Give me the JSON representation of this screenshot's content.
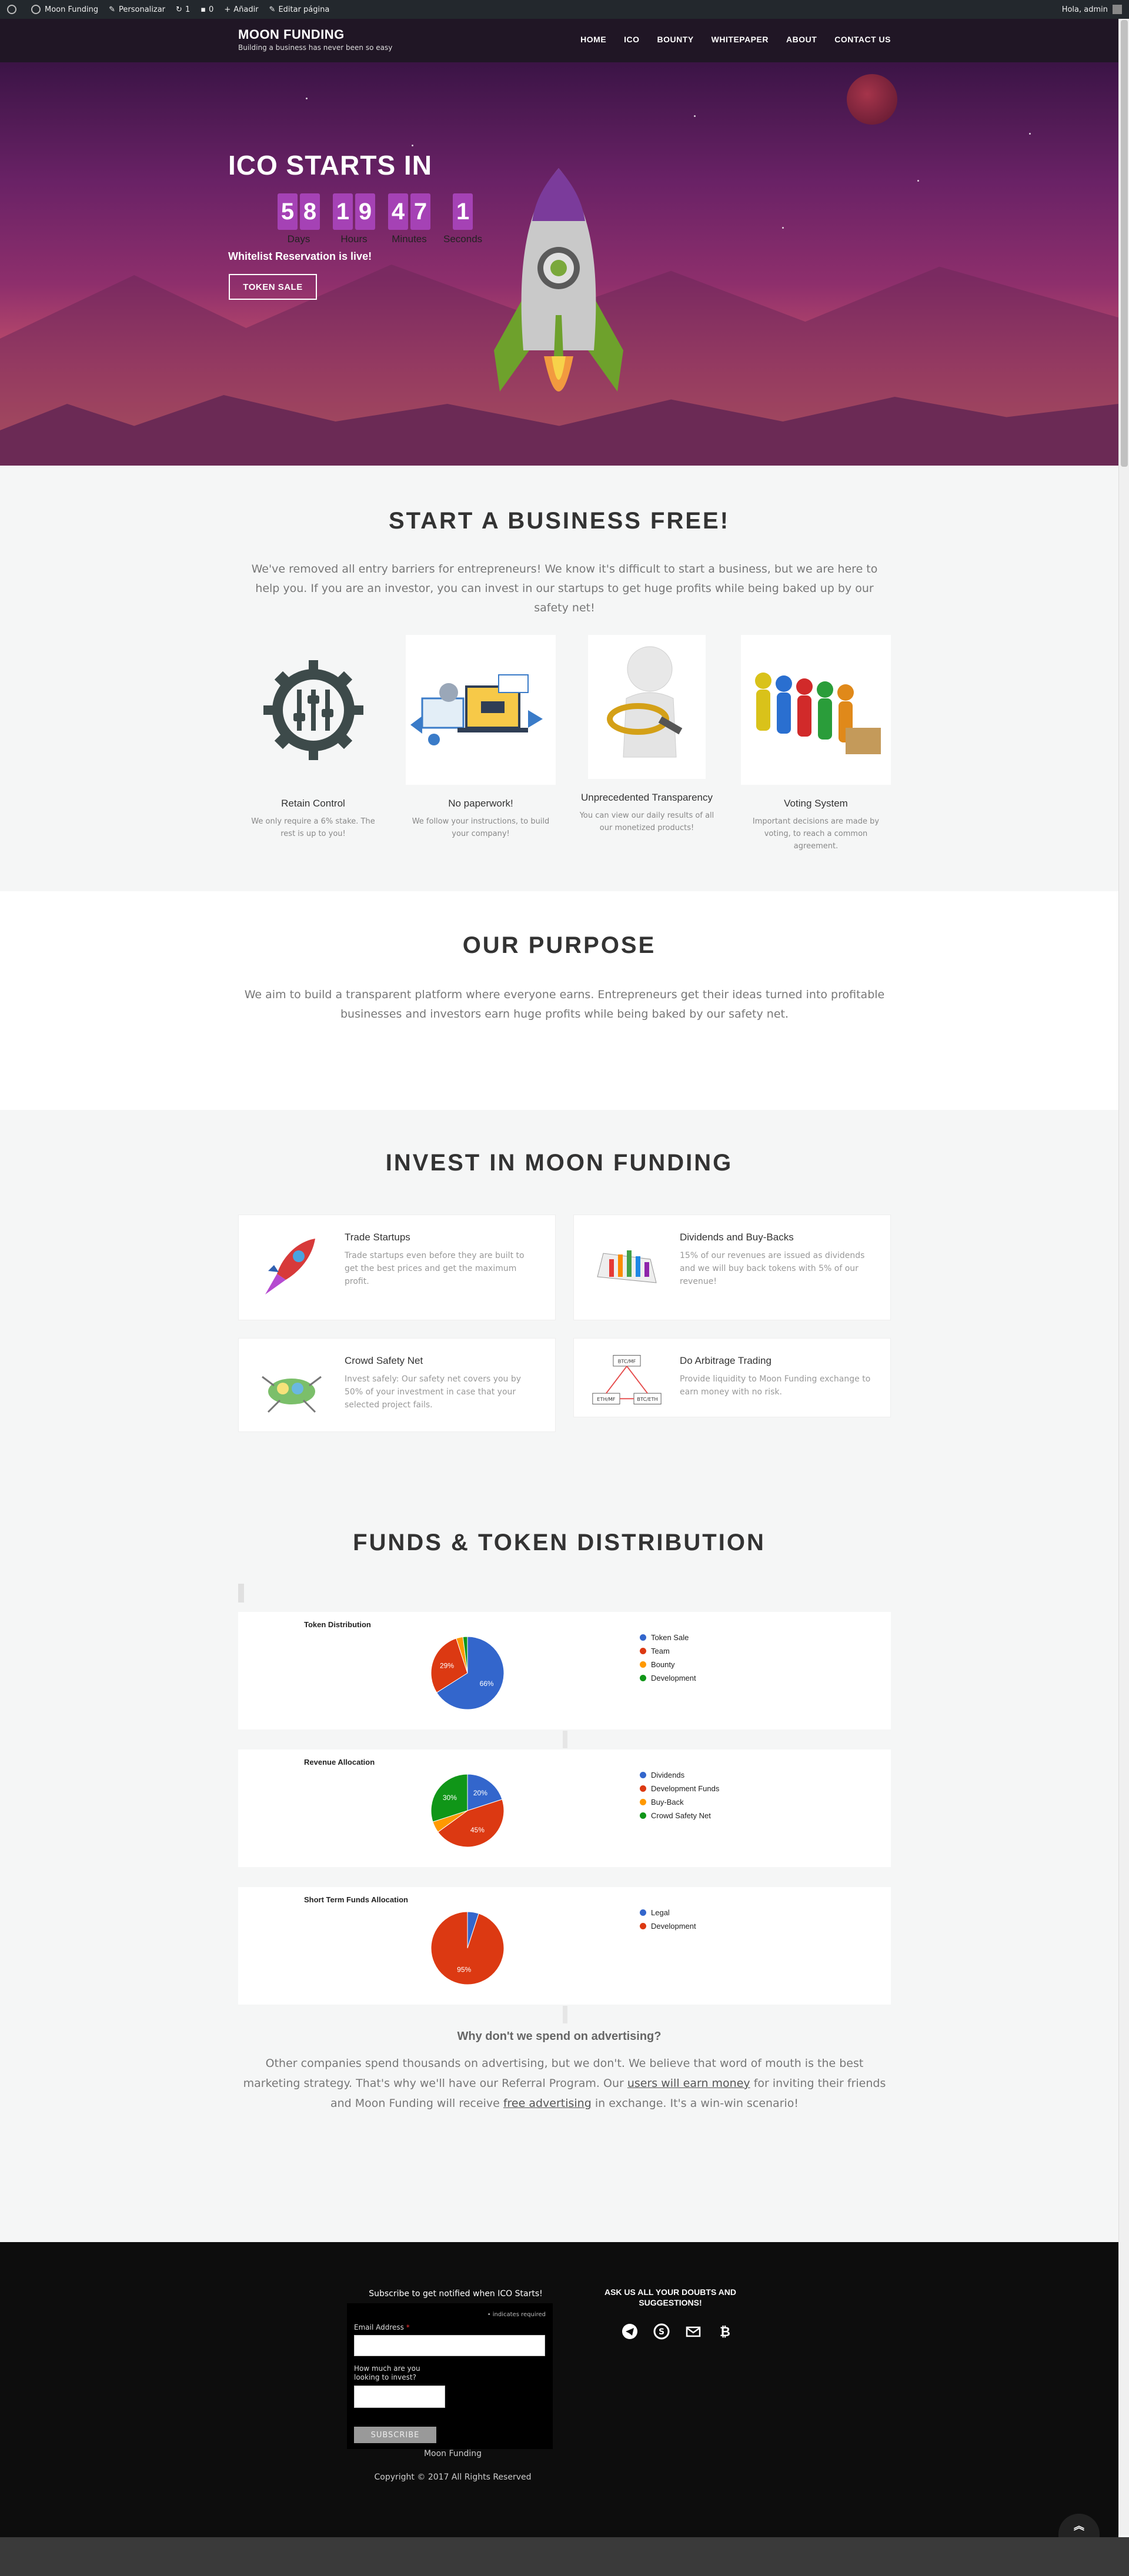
{
  "admin_bar": {
    "site_name": "Moon Funding",
    "customize": "Personalizar",
    "updates": "1",
    "comments": "0",
    "add": "Añadir",
    "edit": "Editar página",
    "greeting": "Hola, admin"
  },
  "header": {
    "title": "MOON FUNDING",
    "tagline": "Building a business has never been so easy",
    "nav": [
      "HOME",
      "ICO",
      "BOUNTY",
      "WHITEPAPER",
      "ABOUT",
      "CONTACT US"
    ]
  },
  "hero": {
    "title": "ICO STARTS IN",
    "countdown": [
      {
        "digits": [
          "5",
          "8"
        ],
        "label": "Days"
      },
      {
        "digits": [
          "1",
          "9"
        ],
        "label": "Hours"
      },
      {
        "digits": [
          "4",
          "7"
        ],
        "label": "Minutes"
      },
      {
        "digits": [
          "1"
        ],
        "label": "Seconds"
      }
    ],
    "whitelist": "Whitelist Reservation is live!",
    "button": "TOKEN SALE"
  },
  "business": {
    "title": "START A BUSINESS FREE!",
    "text": "We've removed all entry barriers for entrepreneurs! We know it's difficult to start a business, but we are here to help you. If you are an investor, you can invest in our startups to get huge profits while being baked up by our safety net!",
    "features": [
      {
        "name": "Retain Control",
        "desc": "We only require a 6% stake. The rest is up to you!",
        "icon": "gear-sliders-icon"
      },
      {
        "name": "No paperwork!",
        "desc": "We follow your instructions, to build your company!",
        "icon": "devices-illustration"
      },
      {
        "name": "Unprecedented Transparency",
        "desc": "You can view our daily results of all our monetized products!",
        "icon": "magnifier-figure"
      },
      {
        "name": "Voting System",
        "desc": "Important decisions are made by voting, to reach a common agreement.",
        "icon": "voting-figures"
      }
    ]
  },
  "purpose": {
    "title": "OUR PURPOSE",
    "text": "We aim to build a transparent platform where everyone earns. Entrepreneurs get their ideas turned into profitable businesses and investors earn huge profits while being baked by our safety net."
  },
  "invest": {
    "title": "INVEST IN MOON FUNDING",
    "cards": [
      {
        "title": "Trade Startups",
        "desc": "Trade startups even before they are built to get the best prices and get the maximum profit.",
        "icon": "rocket-icon"
      },
      {
        "title": "Dividends and Buy-Backs",
        "desc": "15% of our revenues are issued as dividends and we will buy back tokens with 5% of our revenue!",
        "icon": "chart-icon"
      },
      {
        "title": "Crowd Safety Net",
        "desc": "Invest safely: Our safety net covers you by 50% of your investment in case that your selected project fails.",
        "icon": "net-icon"
      },
      {
        "title": "Do Arbitrage Trading",
        "desc": "Provide liquidity to Moon Funding exchange to earn money with no risk.",
        "icon": "arbitrage-icon",
        "nodes": [
          "BTC/MF",
          "ETH/MF",
          "BTC/ETH"
        ]
      }
    ]
  },
  "funds": {
    "title": "FUNDS & TOKEN DISTRIBUTION",
    "why_title": "Why don't we spend on advertising?",
    "why_text_1": "Other companies spend thousands on advertising, but we don't. We believe that word of mouth is the best marketing strategy. That's why we'll have our Referral Program. Our ",
    "why_link_1": "users will earn money",
    "why_text_2": " for inviting their friends and Moon Funding will receive ",
    "why_link_2": "free advertising",
    "why_text_3": " in exchange. It's a win-win scenario!"
  },
  "chart_data": [
    {
      "type": "pie",
      "title": "Token Distribution",
      "labels": [
        "Token Sale",
        "Team",
        "Bounty",
        "Development"
      ],
      "values": [
        66,
        29,
        3,
        2
      ],
      "slice_labels": [
        "66%",
        "29%",
        "",
        ""
      ],
      "colors": [
        "#3366cc",
        "#dc3912",
        "#ff9900",
        "#109618"
      ],
      "legend": "right"
    },
    {
      "type": "pie",
      "title": "Revenue Allocation",
      "labels": [
        "Dividends",
        "Development Funds",
        "Buy-Back",
        "Crowd Safety Net"
      ],
      "values": [
        20,
        45,
        5,
        30
      ],
      "slice_labels": [
        "20%",
        "45%",
        "",
        "30%"
      ],
      "colors": [
        "#3366cc",
        "#dc3912",
        "#ff9900",
        "#109618"
      ],
      "legend": "right"
    },
    {
      "type": "pie",
      "title": "Short Term Funds Allocation",
      "labels": [
        "Legal",
        "Development"
      ],
      "values": [
        5,
        95
      ],
      "slice_labels": [
        "",
        "95%"
      ],
      "colors": [
        "#3366cc",
        "#dc3912"
      ],
      "legend": "right"
    }
  ],
  "footer": {
    "subscribe_head": "Subscribe to get notified when ICO Starts!",
    "required_note": "• indicates required",
    "email_label": "Email Address",
    "invest_label": "How much are you looking to invest?",
    "subscribe_button": "SUBSCRIBE",
    "ask": "ASK US ALL YOUR DOUBTS AND SUGGESTIONS!",
    "site_name": "Moon Funding",
    "copyright": "Copyright © 2017 All Rights Reserved"
  }
}
